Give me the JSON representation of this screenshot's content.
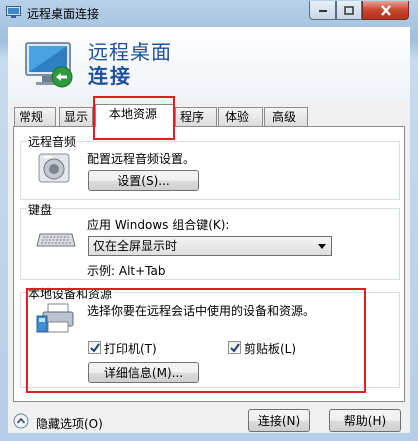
{
  "window": {
    "title": "远程桌面连接"
  },
  "banner": {
    "line1": "远程桌面",
    "line2": "连接"
  },
  "tabs": [
    {
      "label": "常规"
    },
    {
      "label": "显示"
    },
    {
      "label": "本地资源"
    },
    {
      "label": "程序"
    },
    {
      "label": "体验"
    },
    {
      "label": "高级"
    }
  ],
  "audio": {
    "group_title": "远程音频",
    "description": "配置远程音频设置。",
    "settings_button": "设置(S)..."
  },
  "keyboard": {
    "group_title": "键盘",
    "description": "应用 Windows 组合键(K):",
    "selected_option": "仅在全屏显示时",
    "example": "示例: Alt+Tab"
  },
  "devices": {
    "group_title": "本地设备和资源",
    "description": "选择你要在远程会话中使用的设备和资源。",
    "printer_label": "打印机(T)",
    "printer_checked": true,
    "clipboard_label": "剪贴板(L)",
    "clipboard_checked": true,
    "details_button": "详细信息(M)..."
  },
  "footer": {
    "hide_options": "隐藏选项(O)",
    "connect_button": "连接(N)",
    "help_button": "帮助(H)"
  },
  "colors": {
    "banner_text": "#1f4e9c",
    "highlight": "#e02020"
  }
}
